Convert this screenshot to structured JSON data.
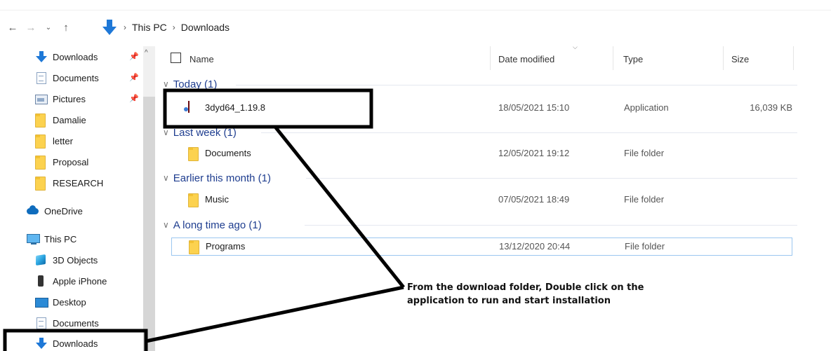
{
  "address_bar": {
    "breadcrumb": [
      "This PC",
      "Downloads"
    ]
  },
  "sidebar": {
    "items": [
      {
        "label": "Downloads",
        "icon": "download-arrow-icon",
        "pinned": true
      },
      {
        "label": "Documents",
        "icon": "documents-icon",
        "pinned": true
      },
      {
        "label": "Pictures",
        "icon": "pictures-icon",
        "pinned": true
      },
      {
        "label": "Damalie",
        "icon": "folder-icon"
      },
      {
        "label": "letter",
        "icon": "folder-icon"
      },
      {
        "label": "Proposal",
        "icon": "folder-icon"
      },
      {
        "label": "RESEARCH",
        "icon": "folder-icon"
      },
      {
        "label": "OneDrive",
        "icon": "onedrive-icon"
      },
      {
        "label": "This PC",
        "icon": "this-pc-icon"
      },
      {
        "label": "3D Objects",
        "icon": "3d-objects-icon"
      },
      {
        "label": "Apple iPhone",
        "icon": "phone-icon"
      },
      {
        "label": "Desktop",
        "icon": "desktop-icon"
      },
      {
        "label": "Documents",
        "icon": "documents-icon"
      },
      {
        "label": "Downloads",
        "icon": "download-arrow-icon"
      }
    ]
  },
  "columns": {
    "name": "Name",
    "date_modified": "Date modified",
    "type": "Type",
    "size": "Size"
  },
  "groups": [
    {
      "label": "Today (1)",
      "files": [
        {
          "name": "3dyd64_1.19.8",
          "date": "18/05/2021 15:10",
          "type": "Application",
          "size": "16,039 KB"
        }
      ]
    },
    {
      "label": "Last week (1)",
      "files": [
        {
          "name": "Documents",
          "date": "12/05/2021 19:12",
          "type": "File folder",
          "size": ""
        }
      ]
    },
    {
      "label": "Earlier this month (1)",
      "files": [
        {
          "name": "Music",
          "date": "07/05/2021 18:49",
          "type": "File folder",
          "size": ""
        }
      ]
    },
    {
      "label": "A long time ago (1)",
      "files": [
        {
          "name": "Programs",
          "date": "13/12/2020 20:44",
          "type": "File folder",
          "size": ""
        }
      ]
    }
  ],
  "annotation": {
    "line1": "From the download folder, Double click on the",
    "line2": "application to run and start installation"
  },
  "colors": {
    "accent_blue": "#1e3d8f",
    "folder_yellow": "#fcd24f",
    "download_blue": "#1e78d7",
    "selection_border": "#9bc7f0"
  }
}
